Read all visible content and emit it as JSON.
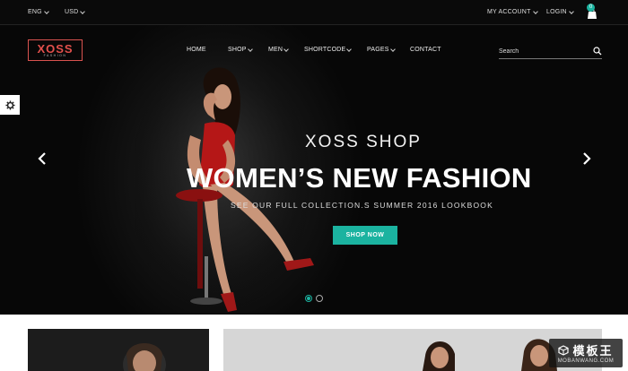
{
  "topbar": {
    "language": "ENG",
    "currency": "USD",
    "my_account": "MY ACCOUNT",
    "login": "LOGIN",
    "cart_count": "0"
  },
  "logo": {
    "name": "XOSS",
    "tagline": "FASHION"
  },
  "nav": [
    "HOME",
    "SHOP",
    "MEN",
    "SHORTCODE",
    "PAGES",
    "CONTACT"
  ],
  "search": {
    "placeholder": "Search"
  },
  "hero": {
    "title": "XOSS SHOP",
    "headline": "WOMEN’S NEW FASHION",
    "subheadline": "SEE OUR FULL COLLECTION.S SUMMER 2016 LOOKBOOK",
    "cta": "SHOP NOW",
    "active_slide": 1,
    "slide_count": 2
  },
  "watermark": {
    "top": "模板王",
    "bottom": "MOBANWANG.COM"
  },
  "colors": {
    "accent": "#1bb3a0",
    "logo": "#e2504c",
    "background": "#0a0a0a"
  }
}
